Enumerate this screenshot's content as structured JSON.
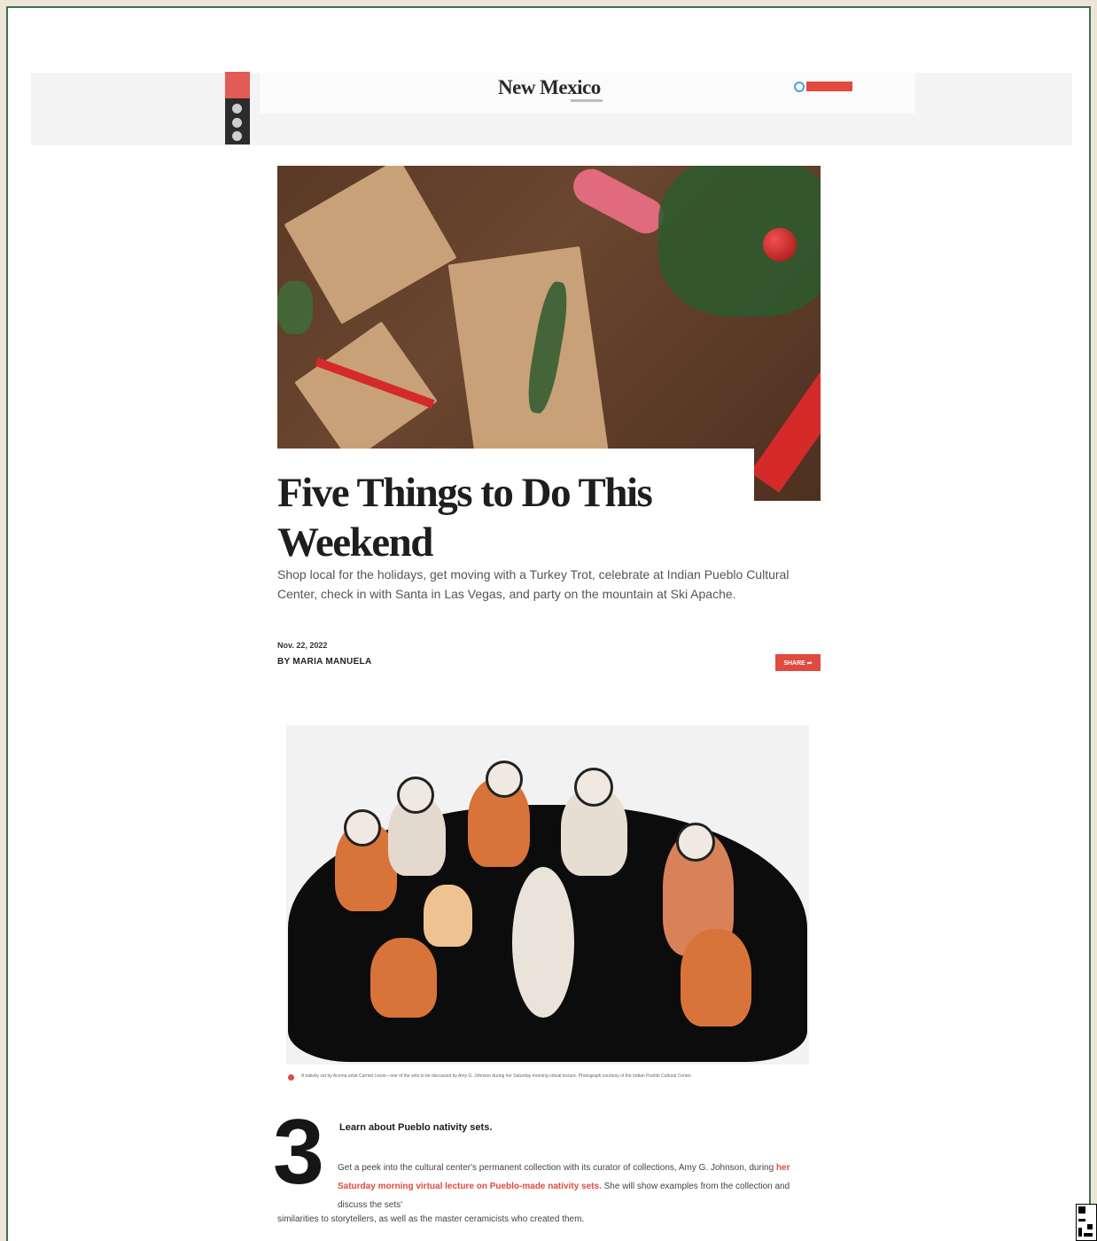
{
  "site": {
    "logo_text": "New Mexico"
  },
  "header": {
    "search_icon": "search-icon",
    "subscribe_color": "#e04a3f"
  },
  "social_rail": {
    "icons": [
      "share-icon",
      "pinterest-icon",
      "facebook-icon",
      "twitter-icon"
    ]
  },
  "article": {
    "headline": "Five Things to Do This Weekend",
    "dek": "Shop local for the holidays, get moving with a Turkey Trot, celebrate at Indian Pueblo Cultural Center, check in with Santa in Las Vegas, and party on the mountain at Ski Apache.",
    "date": "Nov. 22, 2022",
    "byline": "BY MARIA MANUELA",
    "share_label": "SHARE ➦"
  },
  "photo2": {
    "caption": "A nativity set by Acoma artist Carmel Lewis—one of the sets to be discussed by Amy G. Johnson during her Saturday morning virtual lecture. Photograph courtesy of the Indian Pueblo Cultural Center."
  },
  "section": {
    "number": "3",
    "heading": "Learn about Pueblo nativity sets.",
    "body_intro": "Get a peek into the cultural center's permanent collection with its curator of collections, Amy G. Johnson, during ",
    "body_link": "her Saturday morning virtual lecture on Pueblo-made nativity sets.",
    "body_after": " She will show examples from the collection and discuss the sets'",
    "body_cont": "similarities to storytellers, as well as the master ceramicists who created them."
  },
  "colors": {
    "accent": "#e04a3f",
    "frame": "#3f6f5a"
  }
}
